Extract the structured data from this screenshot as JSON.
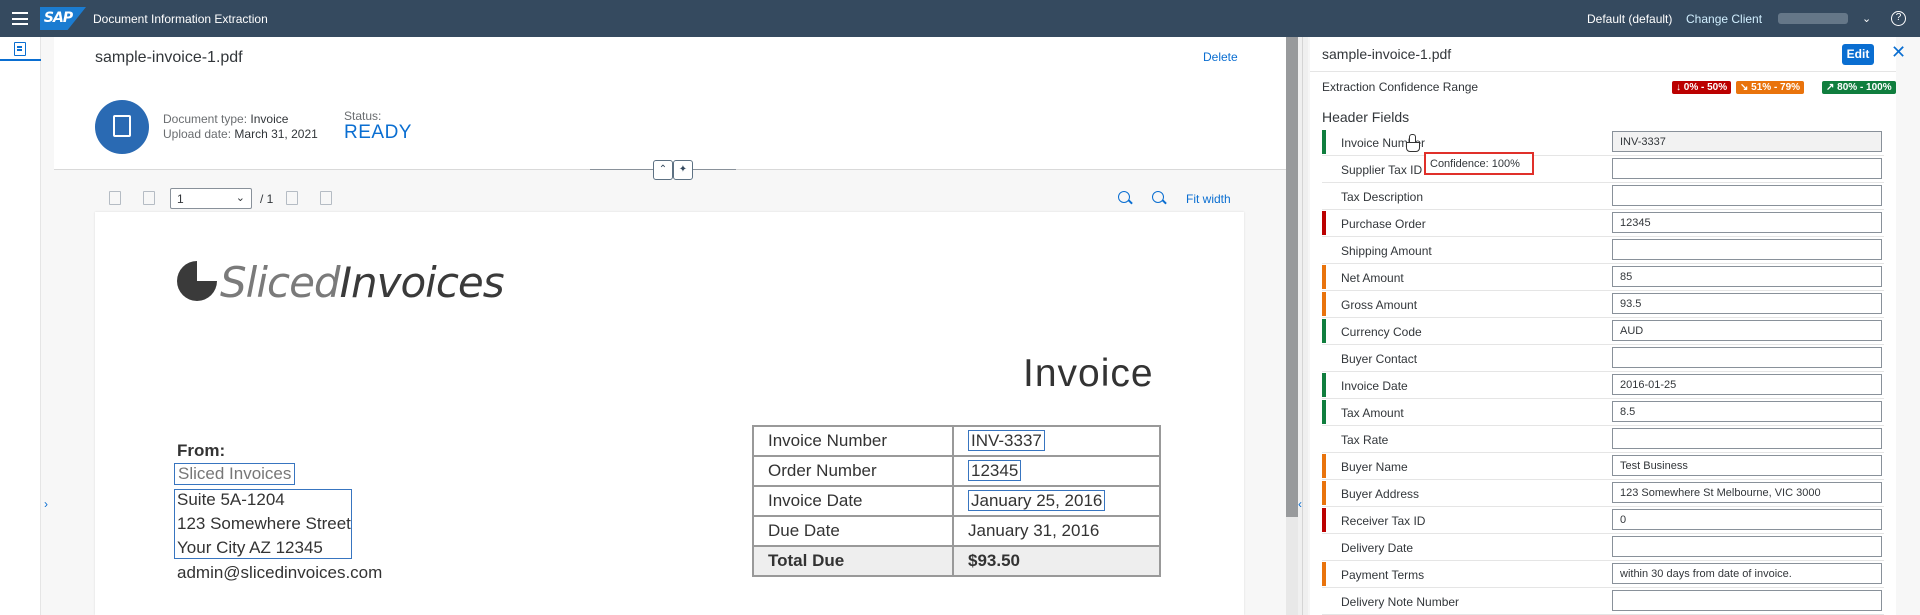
{
  "shell": {
    "logo": "SAP",
    "app_title": "Document Information Extraction",
    "client": "Default (default)",
    "change_client": "Change Client",
    "help": "?"
  },
  "document": {
    "file_name": "sample-invoice-1.pdf",
    "delete_label": "Delete",
    "type_label": "Document type:",
    "type_value": "Invoice",
    "upload_label": "Upload date:",
    "upload_value": "March 31, 2021",
    "status_label": "Status:",
    "status_value": "READY"
  },
  "viewer": {
    "page_value": "1",
    "page_of": "/ 1",
    "fit_width": "Fit width"
  },
  "pdf": {
    "logo_left": "Sliced",
    "logo_right": "Invoices",
    "title": "Invoice",
    "from_label": "From:",
    "from_name": "Sliced Invoices",
    "address": [
      "Suite 5A-1204",
      "123 Somewhere Street",
      "Your City AZ 12345"
    ],
    "email": "admin@slicedinvoices.com",
    "table": [
      {
        "label": "Invoice Number",
        "value": "INV-3337"
      },
      {
        "label": "Order Number",
        "value": "12345"
      },
      {
        "label": "Invoice Date",
        "value": "January 25, 2016"
      },
      {
        "label": "Due Date",
        "value": "January 31, 2016"
      },
      {
        "label": "Total Due",
        "value": "$93.50"
      }
    ]
  },
  "panel": {
    "file_name": "sample-invoice-1.pdf",
    "edit_label": "Edit",
    "confidence_range_label": "Extraction Confidence Range",
    "legend": [
      {
        "text": "↓ 0% - 50%",
        "color": "#bb0000"
      },
      {
        "text": "↘ 51% - 79%",
        "color": "#e9730c"
      },
      {
        "text": "↗ 80% - 100%",
        "color": "#107e3e"
      }
    ],
    "section_title": "Header Fields",
    "tooltip": "Confidence: 100%",
    "fields": [
      {
        "label": "Invoice Number",
        "value": "INV-3337",
        "conf": "green"
      },
      {
        "label": "Supplier Tax ID",
        "value": "",
        "conf": "none"
      },
      {
        "label": "Tax Description",
        "value": "",
        "conf": "none"
      },
      {
        "label": "Purchase Order",
        "value": "12345",
        "conf": "red"
      },
      {
        "label": "Shipping Amount",
        "value": "",
        "conf": "none"
      },
      {
        "label": "Net Amount",
        "value": "85",
        "conf": "orange"
      },
      {
        "label": "Gross Amount",
        "value": "93.5",
        "conf": "orange"
      },
      {
        "label": "Currency Code",
        "value": "AUD",
        "conf": "green"
      },
      {
        "label": "Buyer Contact",
        "value": "",
        "conf": "none"
      },
      {
        "label": "Invoice Date",
        "value": "2016-01-25",
        "conf": "green"
      },
      {
        "label": "Tax Amount",
        "value": "8.5",
        "conf": "green"
      },
      {
        "label": "Tax Rate",
        "value": "",
        "conf": "none"
      },
      {
        "label": "Buyer Name",
        "value": "Test Business",
        "conf": "orange"
      },
      {
        "label": "Buyer Address",
        "value": "123 Somewhere St Melbourne, VIC 3000",
        "conf": "orange"
      },
      {
        "label": "Receiver Tax ID",
        "value": "0",
        "conf": "red"
      },
      {
        "label": "Delivery Date",
        "value": "",
        "conf": "none"
      },
      {
        "label": "Payment Terms",
        "value": "within 30 days from date of invoice.",
        "conf": "orange"
      },
      {
        "label": "Delivery Note Number",
        "value": "",
        "conf": "none"
      }
    ]
  },
  "colors": {
    "green": "#107e3e",
    "orange": "#e9730c",
    "red": "#bb0000",
    "accent": "#0a6ed1",
    "shell": "#354a5f"
  }
}
